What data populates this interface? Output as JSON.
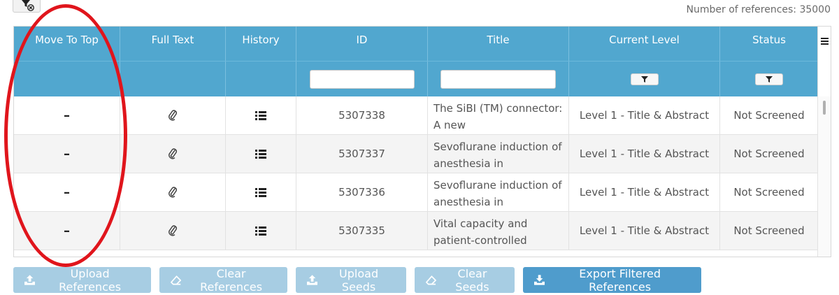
{
  "header": {
    "reference_count_text": "Number of references: 35000"
  },
  "grid": {
    "columns": [
      {
        "key": "move_to_top",
        "label": "Move To Top"
      },
      {
        "key": "full_text",
        "label": "Full Text"
      },
      {
        "key": "history",
        "label": "History"
      },
      {
        "key": "id",
        "label": "ID"
      },
      {
        "key": "title",
        "label": "Title"
      },
      {
        "key": "current_level",
        "label": "Current Level"
      },
      {
        "key": "status",
        "label": "Status"
      }
    ],
    "rows": [
      {
        "move": "–",
        "id": "5307338",
        "title": "The SiBI (TM) connector: A new",
        "level": "Level 1 - Title & Abstract",
        "status": "Not Screened"
      },
      {
        "move": "–",
        "id": "5307337",
        "title": "Sevoflurane induction of anesthesia in",
        "level": "Level 1 - Title & Abstract",
        "status": "Not Screened"
      },
      {
        "move": "–",
        "id": "5307336",
        "title": "Sevoflurane induction of anesthesia in",
        "level": "Level 1 - Title & Abstract",
        "status": "Not Screened"
      },
      {
        "move": "–",
        "id": "5307335",
        "title": "Vital capacity and patient-controlled",
        "level": "Level 1 - Title & Abstract",
        "status": "Not Screened"
      }
    ]
  },
  "buttons": {
    "upload_references": "Upload References",
    "clear_references": "Clear References",
    "upload_seeds": "Upload Seeds",
    "clear_seeds": "Clear Seeds",
    "export_filtered": "Export Filtered References"
  },
  "icons": {
    "clear_filter": "filter-clear-icon",
    "column_menu": "menu-icon",
    "full_text": "paperclip-icon",
    "history": "list-icon",
    "upload": "upload-icon",
    "eraser": "eraser-icon",
    "download": "download-icon"
  },
  "colors": {
    "header_blue": "#51a7cf",
    "button_disabled": "#a7cde3",
    "button_primary": "#4f9ccc",
    "annotation_red": "#e0151c"
  }
}
